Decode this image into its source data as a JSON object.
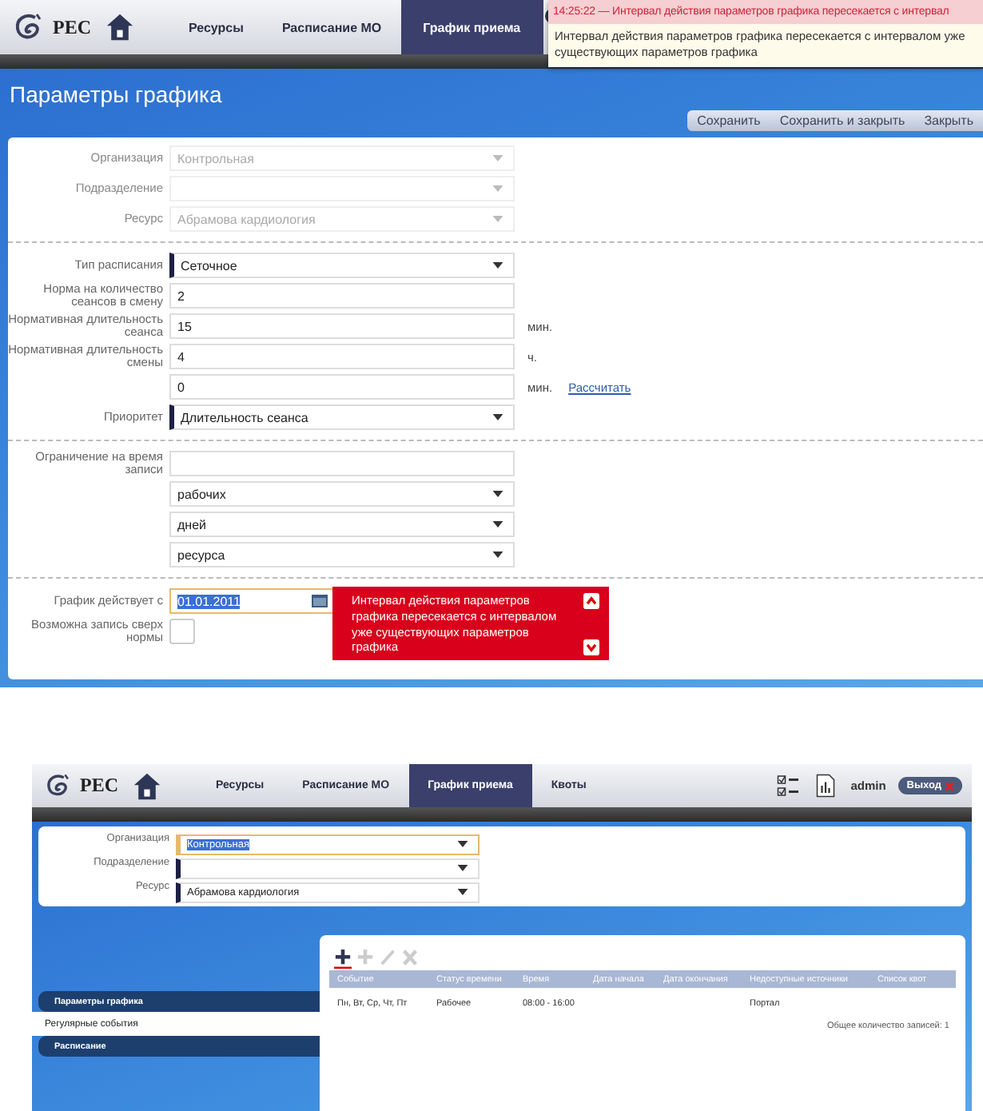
{
  "top": {
    "logo": "РЕС",
    "nav": [
      {
        "label": "Ресурсы",
        "selected": false
      },
      {
        "label": "Расписание МО",
        "selected": false
      },
      {
        "label": "График приема",
        "selected": true
      }
    ],
    "notification": {
      "time": "14:25:22",
      "headline": "— Интервал действия параметров графика пересекается с интервал",
      "message": "Интервал действия параметров графика пересекается с интервалом уже существующих параметров графика"
    },
    "title": "Параметры графика",
    "buttons": [
      "Сохранить",
      "Сохранить и закрыть",
      "Закрыть"
    ],
    "sections": [
      {
        "fields": [
          {
            "label": "Организация",
            "kind": "select",
            "value": "Контрольная",
            "disabled": true
          },
          {
            "label": "Подразделение",
            "kind": "select",
            "disabled": true
          },
          {
            "label": "Ресурс",
            "kind": "select",
            "value": "Абрамова кардиология",
            "disabled": true
          }
        ]
      },
      {
        "fields": [
          {
            "label": "Тип расписания",
            "kind": "select",
            "value": "Сеточное",
            "required": true
          },
          {
            "label": "Норма на количество сеансов в смену",
            "kind": "input",
            "value": "2"
          },
          {
            "label": "Нормативная длительность сеанса",
            "kind": "input",
            "value": "15",
            "unit": "мин."
          },
          {
            "label": "Нормативная длительность смены",
            "kind": "input",
            "value": "4",
            "unit": "ч."
          },
          {
            "kind": "input",
            "value": "0",
            "unit": "мин.",
            "link": "Рассчитать"
          },
          {
            "label": "Приоритет",
            "kind": "select",
            "value": "Длительность сеанса",
            "required": true
          }
        ]
      },
      {
        "fields": [
          {
            "label": "Ограничение на время записи",
            "kind": "input"
          },
          {
            "kind": "select",
            "value": "рабочих"
          },
          {
            "kind": "select",
            "value": "дней"
          },
          {
            "kind": "select",
            "value": "ресурса"
          }
        ]
      },
      {
        "fields": [
          {
            "label": "График действует с",
            "kind": "date",
            "value": "01.01.2011",
            "focused": true,
            "error": "Интервал действия параметров графика пересекается с интервалом уже существующих параметров графика"
          },
          {
            "label": "Возможна запись сверх нормы",
            "kind": "checkbox",
            "checked": false
          }
        ]
      }
    ]
  },
  "bottom": {
    "logo": "РЕС",
    "nav": [
      {
        "label": "Ресурсы",
        "selected": false
      },
      {
        "label": "Расписание МО",
        "selected": false
      },
      {
        "label": "График приема",
        "selected": true
      },
      {
        "label": "Квоты",
        "selected": false
      }
    ],
    "user": "admin",
    "logout": "Выход",
    "fields": [
      {
        "label": "Организация",
        "kind": "select",
        "value": "Контрольная",
        "required": true,
        "focused": true
      },
      {
        "label": "Подразделение",
        "kind": "select",
        "required": true
      },
      {
        "label": "Ресурс",
        "kind": "select",
        "value": "Абрамова кардиология",
        "required": true
      }
    ],
    "sidebar": [
      {
        "label": "Параметры графика",
        "selected": false
      },
      {
        "label": "Регулярные события",
        "selected": true
      },
      {
        "label": "Расписание",
        "selected": false
      }
    ],
    "toolbar": [
      {
        "kind": "add",
        "disabled": false
      },
      {
        "kind": "add",
        "disabled": true
      },
      {
        "kind": "edit",
        "disabled": true
      },
      {
        "kind": "delete",
        "disabled": true
      }
    ],
    "table": {
      "columns": [
        "Событие",
        "Статус времени",
        "Время",
        "Дата начала",
        "Дата окончания",
        "Недоступные источники",
        "Список квот"
      ],
      "rows": [
        {
          "cells": [
            "Пн, Вт, Ср, Чт, Пт",
            "Рабочее",
            "08:00 - 16:00",
            null,
            null,
            "Портал",
            null
          ]
        }
      ],
      "total": "Общее количество записей: 1"
    }
  }
}
